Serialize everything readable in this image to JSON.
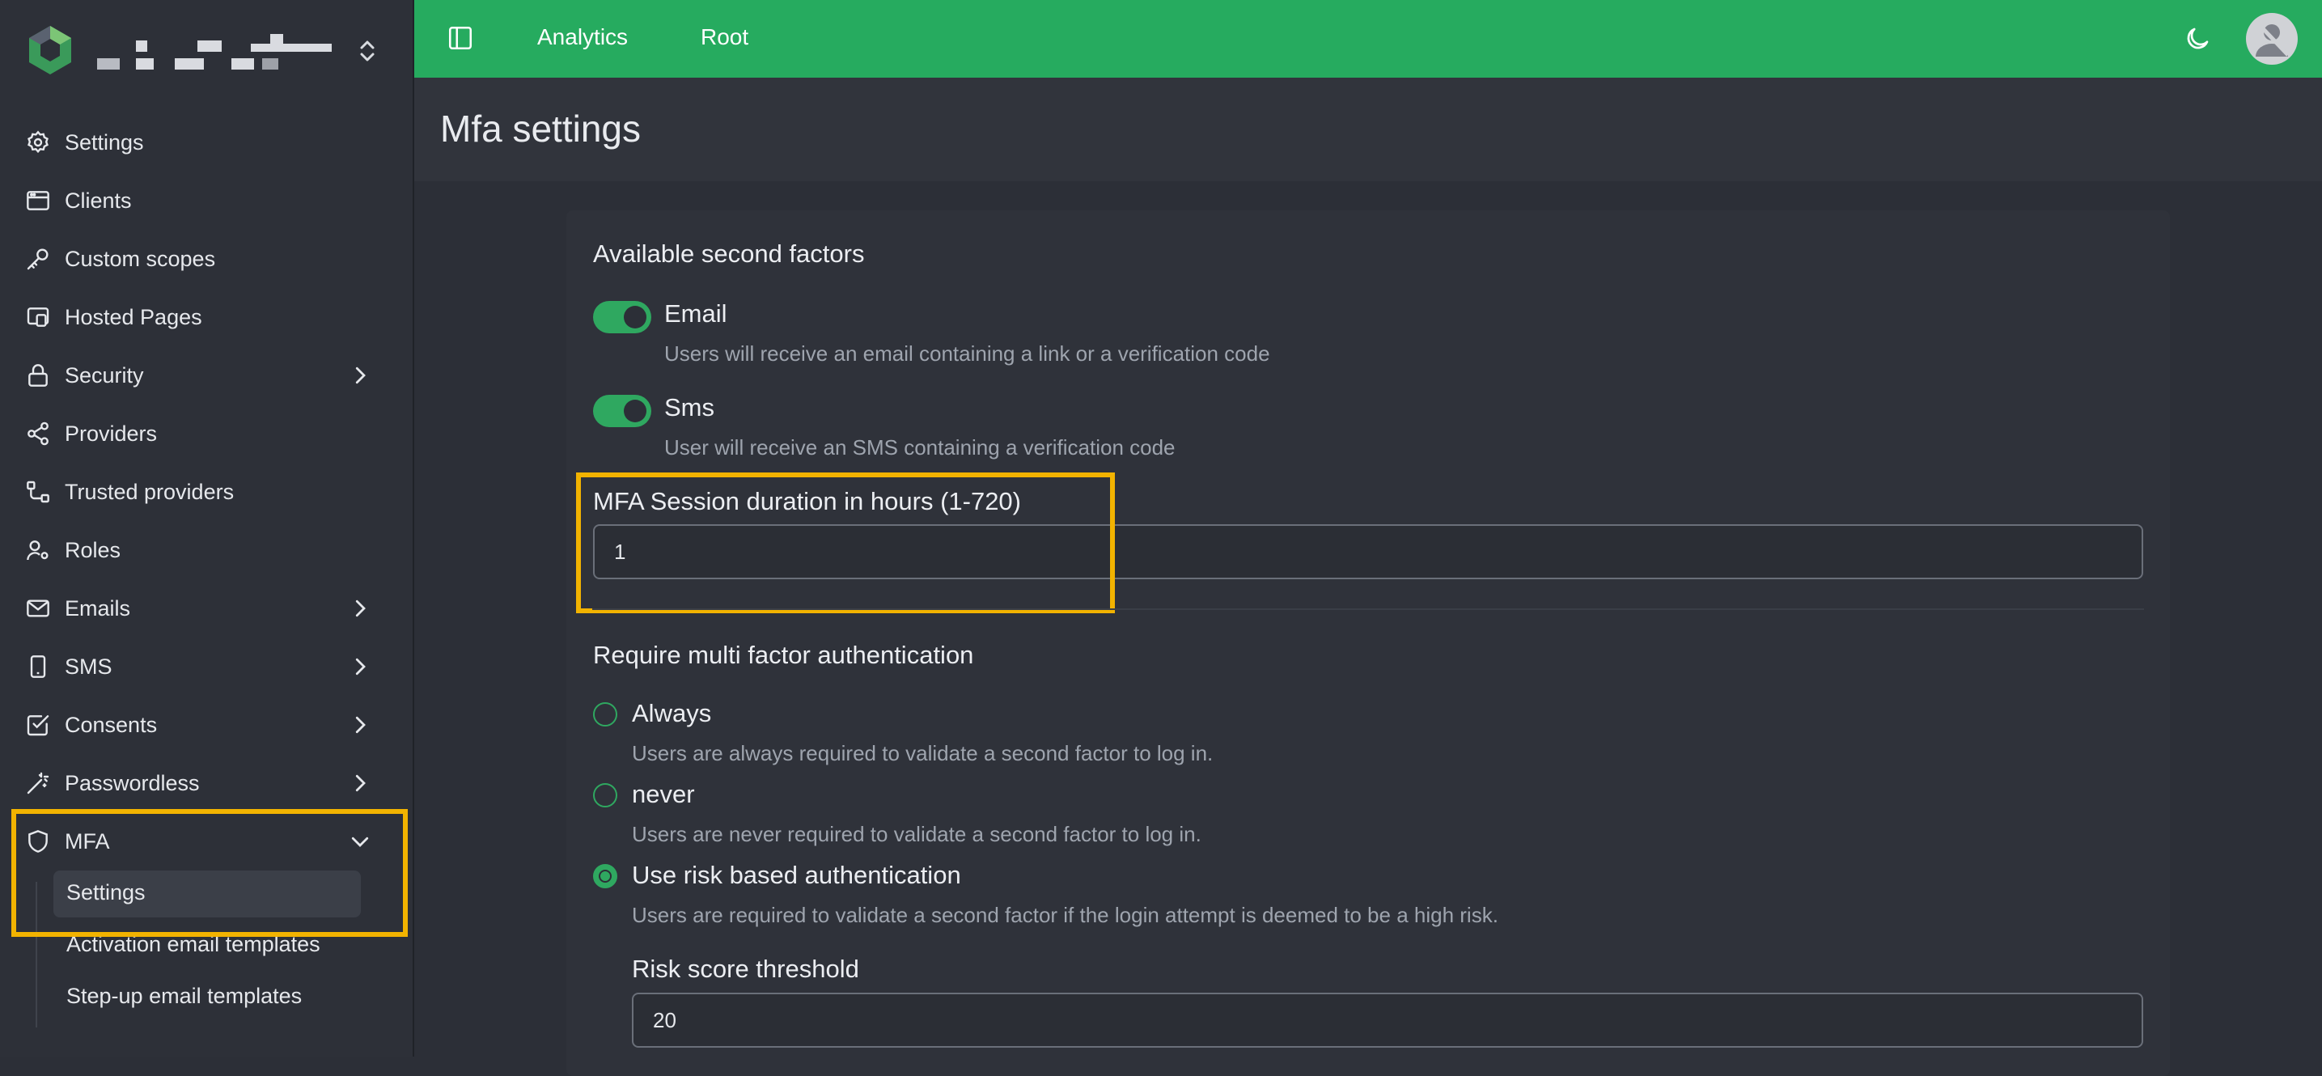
{
  "topbar": {
    "links": [
      "Analytics",
      "Root"
    ]
  },
  "sidebar": {
    "items": [
      {
        "label": "Settings",
        "icon": "gear-icon",
        "chevron": false
      },
      {
        "label": "Clients",
        "icon": "browser-window-icon",
        "chevron": false
      },
      {
        "label": "Custom scopes",
        "icon": "key-icon",
        "chevron": false
      },
      {
        "label": "Hosted Pages",
        "icon": "hosted-pages-icon",
        "chevron": false
      },
      {
        "label": "Security",
        "icon": "lock-icon",
        "chevron": true
      },
      {
        "label": "Providers",
        "icon": "share-icon",
        "chevron": false
      },
      {
        "label": "Trusted providers",
        "icon": "trusted-providers-icon",
        "chevron": false
      },
      {
        "label": "Roles",
        "icon": "user-roles-icon",
        "chevron": false
      },
      {
        "label": "Emails",
        "icon": "mail-icon",
        "chevron": true
      },
      {
        "label": "SMS",
        "icon": "phone-icon",
        "chevron": true
      },
      {
        "label": "Consents",
        "icon": "checkbox-icon",
        "chevron": true
      },
      {
        "label": "Passwordless",
        "icon": "magic-wand-icon",
        "chevron": true
      },
      {
        "label": "MFA",
        "icon": "shield-icon",
        "chevron": true
      }
    ],
    "mfa_subitems": [
      "Settings",
      "Activation email templates",
      "Step-up email templates"
    ]
  },
  "page": {
    "title": "Mfa settings"
  },
  "factors": {
    "title": "Available second factors",
    "email": {
      "label": "Email",
      "desc": "Users will receive an email containing a link or a verification code",
      "enabled": true
    },
    "sms": {
      "label": "Sms",
      "desc": "User will receive an SMS containing a verification code",
      "enabled": true
    }
  },
  "session": {
    "label": "MFA Session duration in hours (1-720)",
    "value": "1"
  },
  "require": {
    "title": "Require multi factor authentication",
    "options": [
      {
        "label": "Always",
        "desc": "Users are always required to validate a second factor to log in.",
        "checked": false
      },
      {
        "label": "never",
        "desc": "Users are never required to validate a second factor to log in.",
        "checked": false
      },
      {
        "label": "Use risk based authentication",
        "desc": "Users are required to validate a second factor if the login attempt is deemed to be a high risk.",
        "checked": true
      }
    ]
  },
  "risk": {
    "label": "Risk score threshold",
    "value": "20"
  },
  "colors": {
    "accent": "#26ab5f",
    "highlight": "#f2b300"
  }
}
